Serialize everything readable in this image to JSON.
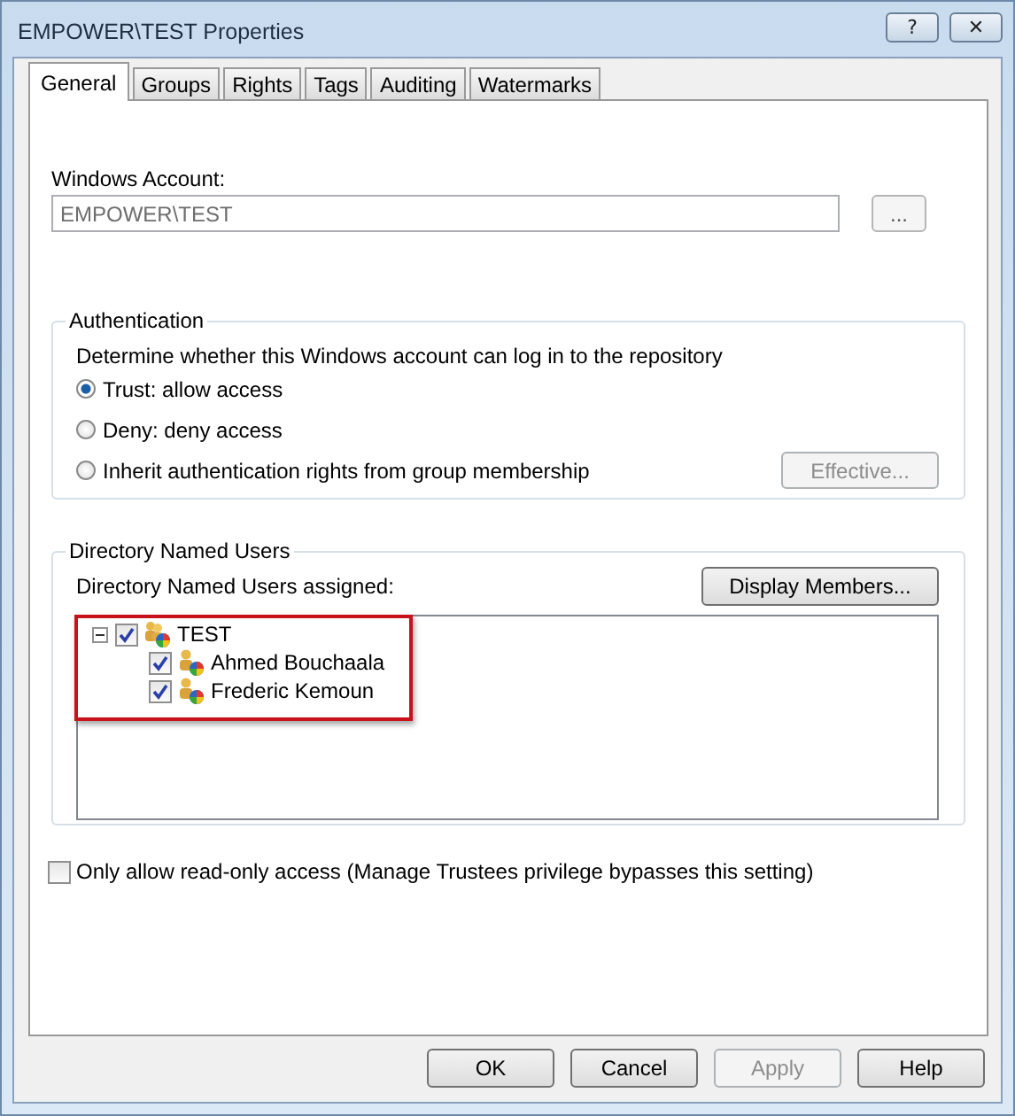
{
  "window": {
    "title": "EMPOWER\\TEST Properties",
    "help_button": "?",
    "close_button": "✕"
  },
  "tabs": [
    {
      "label": "General",
      "selected": true
    },
    {
      "label": "Groups",
      "selected": false
    },
    {
      "label": "Rights",
      "selected": false
    },
    {
      "label": "Tags",
      "selected": false
    },
    {
      "label": "Auditing",
      "selected": false
    },
    {
      "label": "Watermarks",
      "selected": false
    }
  ],
  "windows_account": {
    "label": "Windows Account:",
    "value": "EMPOWER\\TEST",
    "disabled": true,
    "browse_button": "..."
  },
  "authentication": {
    "title": "Authentication",
    "description": "Determine whether this Windows account can log in to the repository",
    "options": [
      {
        "label": "Trust: allow access",
        "selected": true
      },
      {
        "label": "Deny: deny access",
        "selected": false
      },
      {
        "label": "Inherit authentication rights from group membership",
        "selected": false
      }
    ],
    "effective_button": {
      "label": "Effective...",
      "disabled": true
    }
  },
  "directory_users": {
    "title": "Directory Named Users",
    "assigned_label": "Directory Named Users assigned:",
    "display_button": "Display Members...",
    "highlighted": true,
    "tree": [
      {
        "label": "TEST",
        "kind": "group",
        "checked": true,
        "expanded": true,
        "children": [
          {
            "label": "Ahmed Bouchaala",
            "kind": "user",
            "checked": true
          },
          {
            "label": "Frederic Kemoun",
            "kind": "user",
            "checked": true
          }
        ]
      }
    ]
  },
  "read_only": {
    "label": "Only allow read-only access (Manage Trustees privilege bypasses this setting)",
    "checked": false
  },
  "buttons": [
    {
      "label": "OK",
      "disabled": false
    },
    {
      "label": "Cancel",
      "disabled": false
    },
    {
      "label": "Apply",
      "disabled": true
    },
    {
      "label": "Help",
      "disabled": false
    }
  ]
}
